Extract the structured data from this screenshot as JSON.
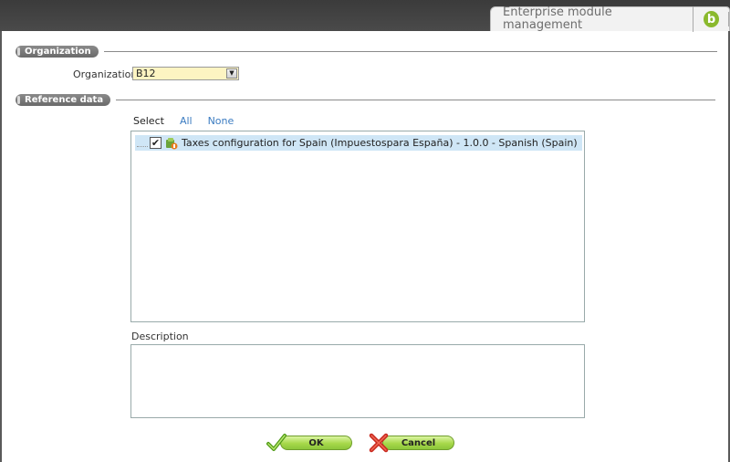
{
  "header": {
    "title": "Enterprise module management",
    "logo_letter": "b"
  },
  "sections": {
    "organization": "Organization",
    "reference_data": "Reference data"
  },
  "organization_field": {
    "label": "Organization",
    "value": "B12"
  },
  "select_row": {
    "label": "Select",
    "all": "All",
    "none": "None"
  },
  "tree": {
    "items": [
      {
        "label": "Taxes configuration for Spain (Impuestospara España) - 1.0.0 - Spanish (Spain)",
        "checked": true
      }
    ]
  },
  "description": {
    "label": "Description",
    "value": ""
  },
  "buttons": {
    "ok": "OK",
    "cancel": "Cancel"
  },
  "colors": {
    "accent_green": "#8ab92d",
    "field_yellow": "#fdf4c2",
    "selection_blue": "#cfe6f6"
  }
}
